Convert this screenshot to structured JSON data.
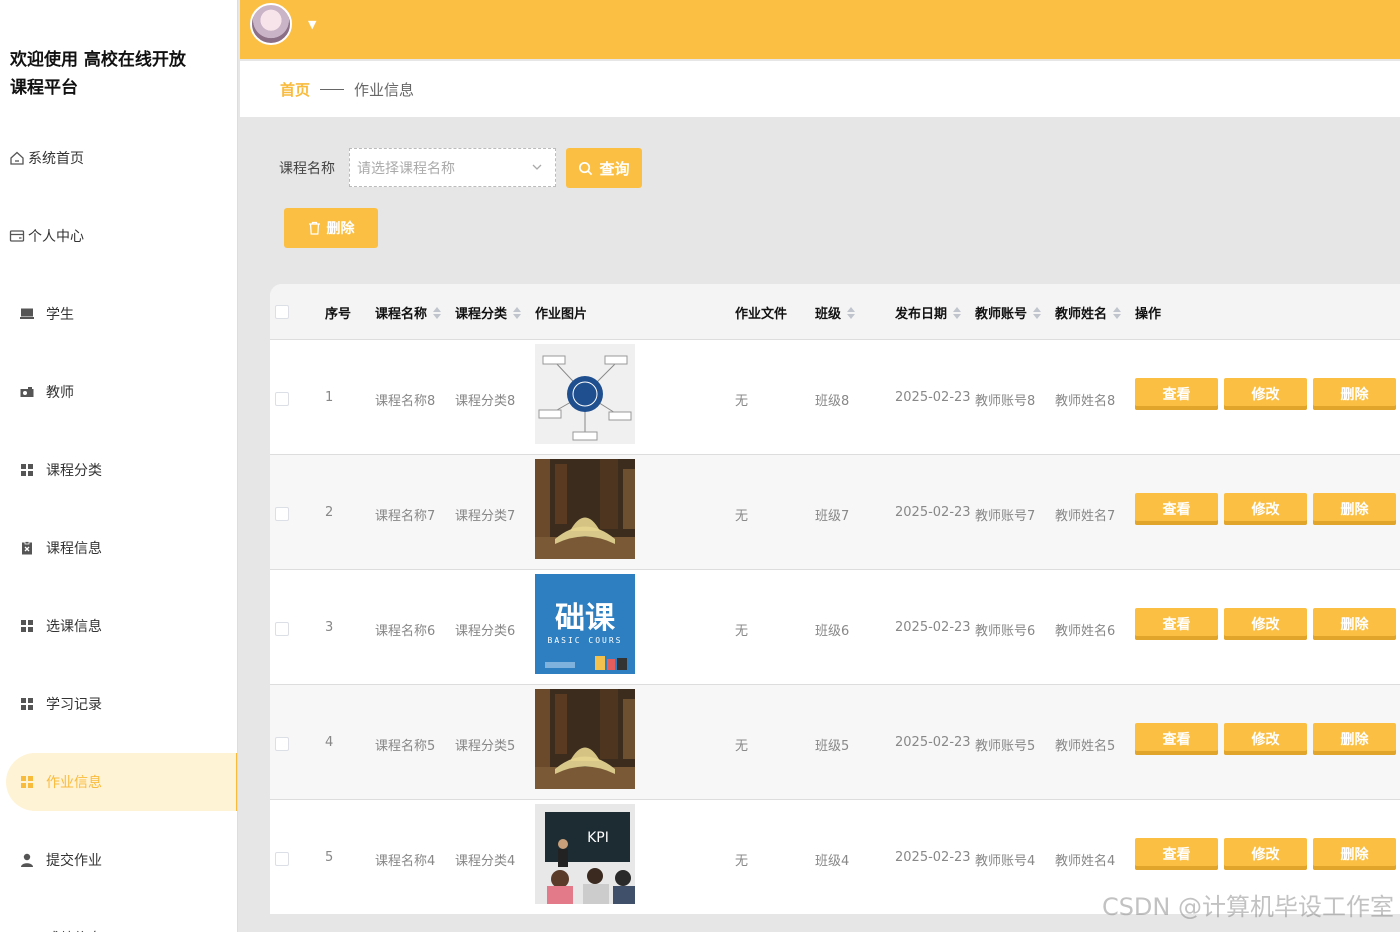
{
  "brand": {
    "line1": "欢迎使用 高校在线开放",
    "line2": "课程平台"
  },
  "sidebar": {
    "items": [
      {
        "label": "系统首页",
        "icon": "home-icon"
      },
      {
        "label": "个人中心",
        "icon": "wallet-icon"
      },
      {
        "label": "学生",
        "icon": "monitor-icon"
      },
      {
        "label": "教师",
        "icon": "camera-icon"
      },
      {
        "label": "课程分类",
        "icon": "grid-icon"
      },
      {
        "label": "课程信息",
        "icon": "clipboard-icon"
      },
      {
        "label": "选课信息",
        "icon": "grid-icon"
      },
      {
        "label": "学习记录",
        "icon": "grid-icon"
      },
      {
        "label": "作业信息",
        "icon": "grid-icon",
        "active": true
      },
      {
        "label": "提交作业",
        "icon": "user-icon"
      },
      {
        "label": "成绩信息",
        "icon": "grid-icon"
      }
    ]
  },
  "topbar": {
    "accent": "#fbbf44"
  },
  "breadcrumb": {
    "home": "首页",
    "current": "作业信息"
  },
  "search": {
    "label": "课程名称",
    "placeholder": "请选择课程名称",
    "query_label": "查询"
  },
  "actions": {
    "delete_label": "删除"
  },
  "table": {
    "headers": {
      "index": "序号",
      "course_name": "课程名称",
      "course_category": "课程分类",
      "image": "作业图片",
      "file": "作业文件",
      "class": "班级",
      "date": "发布日期",
      "teacher_account": "教师账号",
      "teacher_name": "教师姓名",
      "ops": "操作"
    },
    "op_labels": {
      "view": "查看",
      "edit": "修改",
      "delete": "删除"
    },
    "rows": [
      {
        "index": "1",
        "course_name": "课程名称8",
        "course_category": "课程分类8",
        "file": "无",
        "class": "班级8",
        "date": "2025-02-23",
        "teacher_account": "教师账号8",
        "teacher_name": "教师姓名8",
        "image": "mindmap"
      },
      {
        "index": "2",
        "course_name": "课程名称7",
        "course_category": "课程分类7",
        "file": "无",
        "class": "班级7",
        "date": "2025-02-23",
        "teacher_account": "教师账号7",
        "teacher_name": "教师姓名7",
        "image": "book"
      },
      {
        "index": "3",
        "course_name": "课程名称6",
        "course_category": "课程分类6",
        "file": "无",
        "class": "班级6",
        "date": "2025-02-23",
        "teacher_account": "教师账号6",
        "teacher_name": "教师姓名6",
        "image": "basic",
        "image_text": "础课",
        "image_sub": "BASIC COURS"
      },
      {
        "index": "4",
        "course_name": "课程名称5",
        "course_category": "课程分类5",
        "file": "无",
        "class": "班级5",
        "date": "2025-02-23",
        "teacher_account": "教师账号5",
        "teacher_name": "教师姓名5",
        "image": "book"
      },
      {
        "index": "5",
        "course_name": "课程名称4",
        "course_category": "课程分类4",
        "file": "无",
        "class": "班级4",
        "date": "2025-02-23",
        "teacher_account": "教师账号4",
        "teacher_name": "教师姓名4",
        "image": "kpi",
        "image_text": "KPI"
      }
    ]
  },
  "watermark": "CSDN @计算机毕设工作室"
}
